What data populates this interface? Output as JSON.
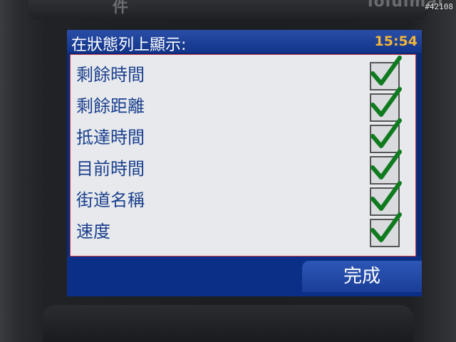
{
  "device": {
    "brand_left": "件",
    "brand_right": "ioiuimai",
    "watermark": "#42108"
  },
  "header": {
    "title": "在狀態列上顯示:",
    "time": "15:54"
  },
  "options": [
    {
      "label": "剩餘時間",
      "checked": true
    },
    {
      "label": "剩餘距離",
      "checked": true
    },
    {
      "label": "抵達時間",
      "checked": true
    },
    {
      "label": "目前時間",
      "checked": true
    },
    {
      "label": "街道名稱",
      "checked": true
    },
    {
      "label": "速度",
      "checked": true
    }
  ],
  "footer": {
    "done_label": "完成"
  },
  "colors": {
    "screen_bg": "#0a2a78",
    "panel_bg": "#e7e9ec",
    "label": "#1a3f8e",
    "check": "#0f7a1e",
    "clock": "#f2b53a"
  },
  "icons": {
    "check": "checkmark-icon"
  }
}
